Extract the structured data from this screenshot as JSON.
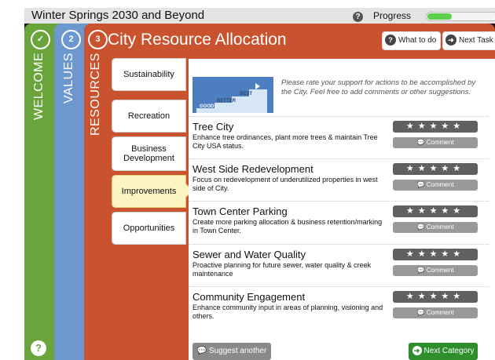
{
  "app": {
    "title": "Winter Springs 2030 and Beyond",
    "progress_label": "Progress",
    "progress_fraction": 0.35,
    "help_glyph": "?"
  },
  "tabs": {
    "welcome": {
      "badge": "✓",
      "label": "WELCOME"
    },
    "values": {
      "badge": "2",
      "label": "VALUES"
    },
    "resources": {
      "badge": "3",
      "label": "RESOURCES"
    }
  },
  "header": {
    "title": "City Resource Allocation",
    "what_to_do": "What to do",
    "next_task": "Next Task"
  },
  "subtabs": [
    {
      "label": "Sustainability"
    },
    {
      "label": "Recreation"
    },
    {
      "label": "Business Development"
    },
    {
      "label": "Improvements"
    },
    {
      "label": "Opportunities"
    }
  ],
  "active_subtab": "Improvements",
  "intro": {
    "image_words": [
      "GOOD",
      "BETTER",
      "BEST"
    ],
    "text": "Please rate your support for actions to be accomplished by the City. Feel free to add comments or other suggestions."
  },
  "items": [
    {
      "title": "Tree City",
      "desc": "Enhance tree ordinances, plant more trees & maintain Tree City USA status.",
      "stars": "★★★★★",
      "comment": "Comment"
    },
    {
      "title": "West Side Redevelopment",
      "desc": "Focus on redevelopment of underutilized properties in west side of City.",
      "stars": "★★★★★",
      "comment": "Comment"
    },
    {
      "title": "Town Center Parking",
      "desc": "Create more parking allocation & business retention/marking in Town Center.",
      "stars": "★★★★★",
      "comment": "Comment"
    },
    {
      "title": "Sewer and Water Quality",
      "desc": "Proactive planning for future sewer, water quality & creek maintenance",
      "stars": "★★★★★",
      "comment": "Comment"
    },
    {
      "title": "Community Engagement",
      "desc": "Enhance community input in areas of planning, visioning and others.",
      "stars": "★★★★★",
      "comment": "Comment"
    }
  ],
  "footer": {
    "suggest": "Suggest another",
    "next_category": "Next Category"
  },
  "colors": {
    "welcome": "#6aa53b",
    "values": "#6d97cf",
    "resources": "#c8532e",
    "accent_green": "#2f8d2b"
  }
}
